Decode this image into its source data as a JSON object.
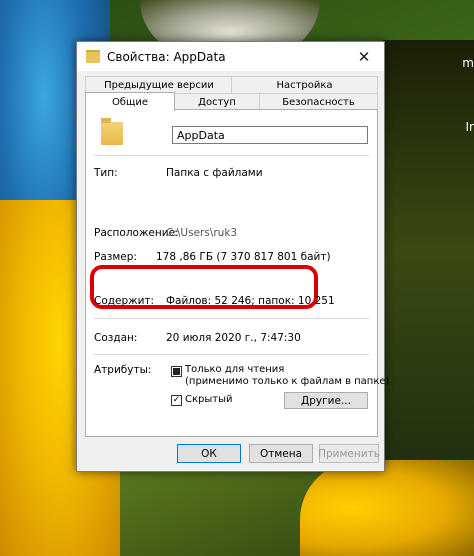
{
  "window": {
    "title": "Свойства: AppData",
    "close_glyph": "✕"
  },
  "tabs": {
    "row1": [
      {
        "label": "Предыдущие версии"
      },
      {
        "label": "Настройка"
      }
    ],
    "row2": [
      {
        "label": "Общие",
        "active": true
      },
      {
        "label": "Доступ"
      },
      {
        "label": "Безопасность"
      }
    ]
  },
  "general": {
    "folder_name": "AppData",
    "type_label": "Тип:",
    "type_value": "Папка с файлами",
    "location_label": "Расположение:",
    "location_value": "C:\\Users\\ruk3",
    "size_label": "Размер:",
    "size_value": "178 ,86 ГБ (7 370 817 801 байт)",
    "contains_label": "Содержит:",
    "contains_value": "Файлов: 52 246; папок: 10 251",
    "created_label": "Создан:",
    "created_value": "20 июля 2020 г., 7:47:30",
    "attributes_label": "Атрибуты:",
    "readonly_label": "Только для чтения",
    "readonly_sub": "(применимо только к файлам в папке)",
    "hidden_label": "Скрытый",
    "hidden_checked_glyph": "✓",
    "other_button": "Другие..."
  },
  "footer": {
    "ok": "ОК",
    "cancel": "Отмена",
    "apply": "Применить"
  },
  "desktop": {
    "mark_top": "m",
    "mark_bottom": "Ir"
  },
  "colors": {
    "highlight": "#d80000",
    "accent": "#0078d7"
  }
}
